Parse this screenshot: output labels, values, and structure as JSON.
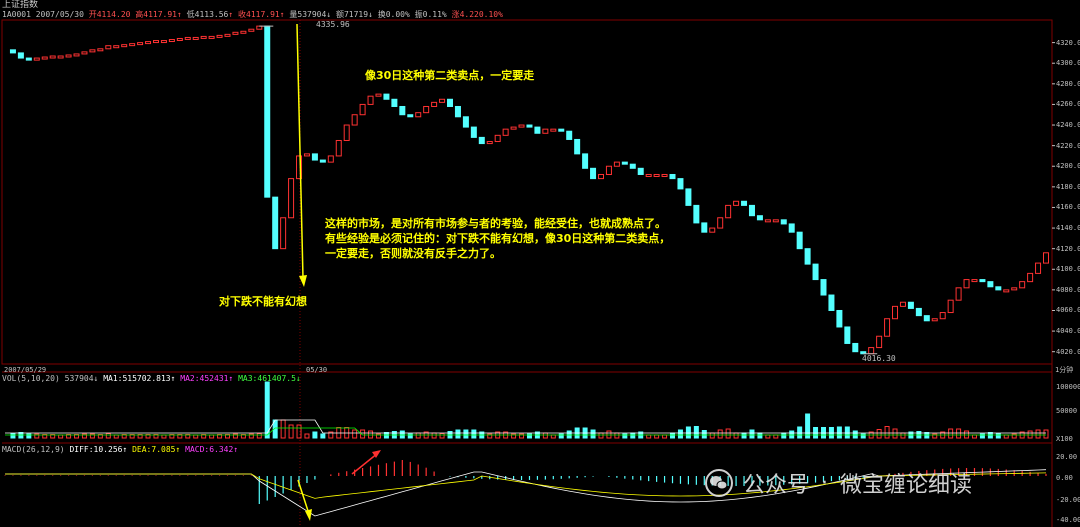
{
  "header": {
    "title": "上证指数",
    "code": "1A0001",
    "date": "2007/05/30",
    "open_label": "开",
    "open": "4114.20",
    "high_label": "高",
    "high": "4117.91",
    "low_label": "低",
    "low": "4113.56",
    "close_label": "收",
    "close": "4117.91",
    "volume_label": "量",
    "volume": "537904",
    "amount_label": "额",
    "amount": "71719",
    "turnover_label": "换",
    "turnover": "0.00%",
    "amplitude_label": "振",
    "amplitude": "0.11%",
    "change_label": "涨",
    "change": "4.22",
    "change_pct": "0.10%"
  },
  "colors": {
    "up": "#ff3232",
    "down": "#54ffff",
    "annotation": "#ffff00",
    "grid": "#800000",
    "ma1": "#ffffff",
    "ma2": "#ff00ff",
    "ma3": "#00ff00"
  },
  "price_axis": {
    "labels": [
      "4320.00",
      "4300.00",
      "4280.00",
      "4260.00",
      "4240.00",
      "4220.00",
      "4200.00",
      "4180.00",
      "4160.00",
      "4140.00",
      "4120.00",
      "4100.00",
      "4080.00",
      "4060.00",
      "4040.00",
      "4020.00"
    ]
  },
  "price_markers": {
    "high": "4335.96",
    "low": "4016.30"
  },
  "time_axis": {
    "start": "2007/05/29",
    "mid": "05/30",
    "end": "1分钟"
  },
  "annotations": {
    "top": "像30日这种第二类卖点，一定要走",
    "middle": [
      "这样的市场，是对所有市场参与者的考验，能经受住，也就成熟点了。",
      "有些经验是必须记住的：对下跌不能有幻想，像30日这种第二类卖点，",
      "一定要走，否则就没有反手之力了。"
    ],
    "bottom": "对下跌不能有幻想"
  },
  "volume_panel": {
    "indicator": "VOL(5,10,20)",
    "value": "537904",
    "ma1_label": "MA1:",
    "ma1": "515702.813",
    "ma2_label": "MA2:",
    "ma2": "452431",
    "ma3_label": "MA3:",
    "ma3": "461407.5",
    "axis": [
      "100000",
      "50000",
      "X100"
    ]
  },
  "macd_panel": {
    "indicator": "MACD(26,12,9)",
    "diff_label": "DIFF:",
    "diff": "10.256",
    "dea_label": "DEA:",
    "dea": "7.085",
    "macd_label": "MACD:",
    "macd": "6.342",
    "axis": [
      "20.00",
      "0.00",
      "-20.00",
      "-40.00"
    ]
  },
  "watermark": {
    "account_label": "公众号",
    "separator": "·",
    "name": "微宝缠论细读"
  },
  "chart_data": {
    "type": "candlestick",
    "title": "上证指数",
    "ylim": [
      4010,
      4340
    ],
    "series": [
      {
        "values": [
          4313,
          4310,
          4305,
          4303,
          4305,
          4306,
          4307,
          4307,
          4308,
          4309,
          4311,
          4313,
          4314,
          4317,
          4317,
          4318,
          4319,
          4320,
          4321,
          4322,
          4322,
          4323,
          4324,
          4325,
          4325,
          4326,
          4326,
          4327,
          4328,
          4330,
          4331,
          4333,
          4336,
          4170,
          4120,
          4150,
          4188,
          4210,
          4212,
          4206,
          4204,
          4210,
          4225,
          4240,
          4250,
          4260,
          4268,
          4270,
          4265,
          4258,
          4250,
          4248,
          4252,
          4258,
          4262,
          4265,
          4258,
          4248,
          4238,
          4228,
          4222,
          4224,
          4230,
          4236,
          4238,
          4240,
          4238,
          4232,
          4236,
          4236,
          4234,
          4226,
          4212,
          4198,
          4188,
          4192,
          4200,
          4204,
          4202,
          4198,
          4192,
          4192,
          4192,
          4192,
          4188,
          4178,
          4162,
          4145,
          4136,
          4140,
          4150,
          4162,
          4166,
          4162,
          4152,
          4148,
          4148,
          4148,
          4144,
          4136,
          4120,
          4105,
          4090,
          4075,
          4060,
          4044,
          4028,
          4020,
          4018,
          4024,
          4035,
          4052,
          4064,
          4068,
          4062,
          4055,
          4050,
          4052,
          4058,
          4070,
          4082,
          4090,
          4090,
          4088,
          4083,
          4080,
          4080,
          4082,
          4088,
          4096,
          4106,
          4116
        ]
      }
    ]
  }
}
